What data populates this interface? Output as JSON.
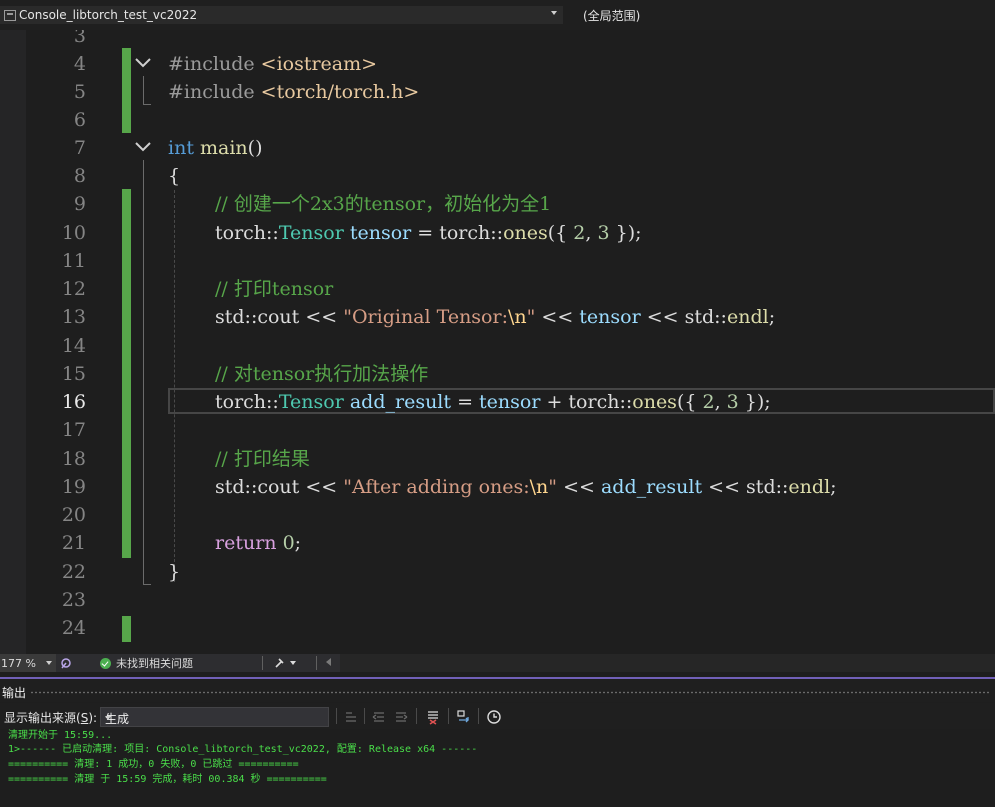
{
  "nav": {
    "project": "Console_libtorch_test_vc2022",
    "scope": "(全局范围)"
  },
  "line_numbers": [
    "3",
    "4",
    "5",
    "6",
    "7",
    "8",
    "9",
    "10",
    "11",
    "12",
    "13",
    "14",
    "15",
    "16",
    "17",
    "18",
    "19",
    "20",
    "21",
    "22",
    "23",
    "24"
  ],
  "active_line": "16",
  "code": {
    "l4": {
      "directive": "#include",
      "header": "<iostream>"
    },
    "l5": {
      "directive": "#include",
      "header": "<torch/torch.h>"
    },
    "l7": {
      "kw": "int",
      "fn": "main",
      "rest": "()"
    },
    "l8": {
      "text": "{"
    },
    "l9": {
      "comment": "// 创建一个2x3的tensor，初始化为全1"
    },
    "l10": {
      "ns": "torch::",
      "type": "Tensor",
      "var": "tensor",
      "eq": " = ",
      "ns2": "torch::",
      "fn": "ones",
      "open": "({ ",
      "n1": "2",
      "comma": ", ",
      "n2": "3",
      "close": " });"
    },
    "l12": {
      "comment": "// 打印tensor"
    },
    "l13": {
      "ns": "std::cout << ",
      "str": "\"Original Tensor:",
      "esc": "\\n",
      "strend": "\"",
      "op": " << ",
      "var": "tensor",
      "tail": " << std::",
      "fn": "endl",
      "semi": ";"
    },
    "l15": {
      "comment": "// 对tensor执行加法操作"
    },
    "l16": {
      "ns": "torch::",
      "type": "Tensor",
      "var": "add_result",
      "eq": " = ",
      "var2": "tensor",
      "plus": " + ",
      "ns2": "torch::",
      "fn": "ones",
      "open": "({ ",
      "n1": "2",
      "comma": ", ",
      "n2": "3",
      "close": " });"
    },
    "l18": {
      "comment": "// 打印结果"
    },
    "l19": {
      "ns": "std::cout << ",
      "str": "\"After adding ones:",
      "esc": "\\n",
      "strend": "\"",
      "op": " << ",
      "var": "add_result",
      "tail": " << std::",
      "fn": "endl",
      "semi": ";"
    },
    "l21": {
      "kw": "return",
      "num": "0",
      "semi": ";"
    },
    "l22": {
      "text": "}"
    }
  },
  "editor_status": {
    "zoom": "177 %",
    "issues": "未找到相关问题"
  },
  "output": {
    "title": "输出",
    "source_label_prefix": "显示输出来源(",
    "source_label_key": "S",
    "source_label_suffix": "):",
    "source_value": "生成",
    "lines": [
      "清理开始于 15:59...",
      "1>------ 已启动清理: 项目: Console_libtorch_test_vc2022, 配置: Release x64 ------",
      "========== 清理: 1 成功，0 失败，0 已跳过 ==========",
      "========== 清理 于 15:59 完成，耗时 00.384 秒 =========="
    ]
  },
  "colors": {
    "background": "#1e1e1e",
    "keyword": "#569cd6",
    "function": "#dcdcaa",
    "type": "#4ec9b0",
    "variable": "#9cdcfe",
    "string": "#d69d85",
    "number": "#b5cea8",
    "comment": "#57a64a",
    "change_bar": "#57a64a",
    "output_text": "#4ade4a",
    "panel_accent": "#7160b8"
  }
}
